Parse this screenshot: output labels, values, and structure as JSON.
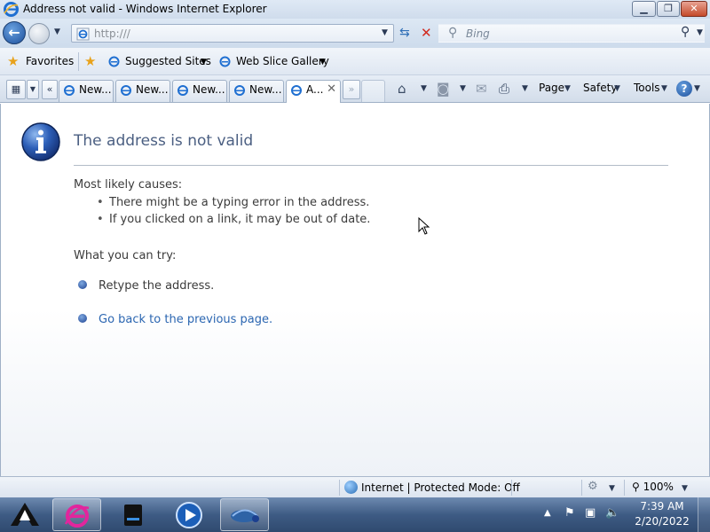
{
  "window": {
    "title": "Address not valid - Windows Internet Explorer",
    "min_label": "▁",
    "max_label": "❐",
    "close_label": "✕"
  },
  "nav": {
    "address_value": "http:///",
    "search_placeholder": "Bing"
  },
  "favorites_bar": {
    "favorites_label": "Favorites",
    "suggested_sites_label": "Suggested Sites",
    "web_slice_gallery_label": "Web Slice Gallery"
  },
  "tabs": [
    {
      "label": "New..."
    },
    {
      "label": "New..."
    },
    {
      "label": "New..."
    },
    {
      "label": "New..."
    },
    {
      "label": "A...",
      "active": true
    }
  ],
  "command_bar": {
    "page_label": "Page",
    "safety_label": "Safety",
    "tools_label": "Tools",
    "help_label": "?"
  },
  "page": {
    "title": "The address is not valid",
    "causes_heading": "Most likely causes:",
    "causes": [
      "There might be a typing error in the address.",
      "If you clicked on a link, it may be out of date."
    ],
    "try_heading": "What you can try:",
    "try_items": [
      {
        "text": "Retype the address.",
        "is_link": false
      },
      {
        "text": "Go back to the previous page.",
        "is_link": true
      }
    ]
  },
  "status_bar": {
    "zone_text": "Internet | Protected Mode: Off",
    "zoom_text": "100%"
  },
  "taskbar": {
    "time": "7:39 AM",
    "date": "2/20/2022"
  },
  "colors": {
    "title_text": "#4b5f82",
    "link": "#2b66b1",
    "chrome": "#d3ddea",
    "taskbar": "#3e5b84"
  },
  "icons": [
    "ie-logo-icon",
    "back-arrow-icon",
    "forward-arrow-icon",
    "refresh-icon",
    "stop-icon",
    "search-icon",
    "star-icon",
    "add-favorite-icon",
    "quick-tabs-icon",
    "home-icon",
    "feeds-icon",
    "mail-icon",
    "print-icon",
    "info-icon",
    "globe-icon",
    "zoom-icon",
    "show-desktop-icon"
  ]
}
